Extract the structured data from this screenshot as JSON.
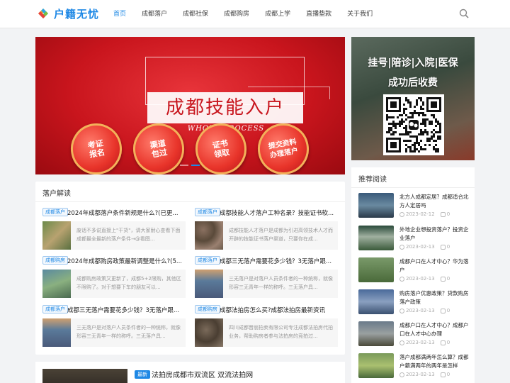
{
  "header": {
    "logo_text": "户籍无忧",
    "nav": [
      "首页",
      "成都落户",
      "成都社保",
      "成都购房",
      "成都上学",
      "直播垫款",
      "关于我们"
    ]
  },
  "banner": {
    "title": "成都技能入户",
    "subtitle": "WHOLE PROCESS",
    "steps": [
      "考证\n报名",
      "渠道\n包过",
      "证书\n领取",
      "提交资料\n办理落户"
    ]
  },
  "ad": {
    "line1": "挂号|陪诊|入院|医保",
    "line2": "成功后收费"
  },
  "articles": {
    "title": "落户解读",
    "items": [
      {
        "tag": "成都落户",
        "title": "2024年成都落户条件新规是什么?(已更...",
        "desc": "废话不多说直接上\"干货\"，请大家耐心查看下面成都最全最新的落户条件→@看图..."
      },
      {
        "tag": "成都落户",
        "title": "成都技能人才落户工种名录？技能证书软...",
        "desc": "成都技能人才落户是成都为引进高领技术人才而开辟的技能证书落户渠道，只要你在成..."
      },
      {
        "tag": "成都购房",
        "title": "2024年成都购房政策最新调整是什么?(5...",
        "desc": "成都购房政策又更新了，成都5+2限购，其他区不限购了。对于想要下车的朋友可以..."
      },
      {
        "tag": "成都落户",
        "title": "成都三无落户需要花多少钱？3无落户跟...",
        "desc": "三无落户是对落户人员条件者的一种统称，就像形容三无青年一样的称呼。三无落户具..."
      },
      {
        "tag": "成都落户",
        "title": "成都三无落户需要花多少钱？3无落户跟...",
        "desc": "三无落户是对落户人员条件者的一种统称，就像形容三无青年一样的称呼。三无落户具..."
      },
      {
        "tag": "成都购房",
        "title": "成都法拍房怎么买?成都法拍房最新资讯",
        "desc": "四川成都晋丽拍卖有限公司专注成都法拍房代拍业务，帮助购房者参与法拍房的竞拍过..."
      }
    ]
  },
  "sidebar": {
    "title": "推荐阅读",
    "items": [
      {
        "title": "北方人成都定居？成都适合北方人定居吗",
        "date": "2023-02-12",
        "comments": "0"
      },
      {
        "title": "外地企业想投资落户？投资企业落户",
        "date": "2023-02-13",
        "comments": "0"
      },
      {
        "title": "成都户口在人才中心？华为落户",
        "date": "2023-02-13",
        "comments": "0"
      },
      {
        "title": "购房落户优惠政策？贷款购房落户政策",
        "date": "2023-02-13",
        "comments": "0"
      },
      {
        "title": "成都户口在人才中心？成都户口在人才中心办理",
        "date": "2023-02-13",
        "comments": "0"
      },
      {
        "title": "落户成都满两年怎么算？成都户籍满两年的两年是怎样",
        "date": "2023-02-13",
        "comments": "0"
      }
    ]
  },
  "bottom": {
    "badge": "最新",
    "title": "法拍房成都市双流区 双流法拍网"
  }
}
